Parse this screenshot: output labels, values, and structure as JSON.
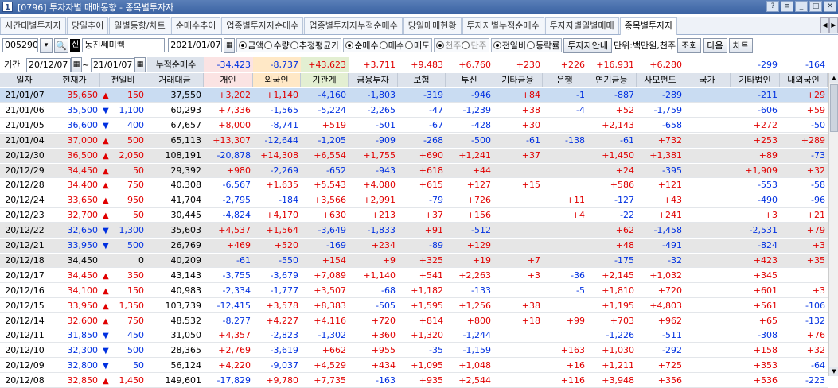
{
  "window": {
    "code": "[0796]",
    "title": "투자자별 매매동향 - 종목별투자자",
    "num": "1"
  },
  "tabs": [
    "시간대별투자자",
    "당일추이",
    "일별동향/차트",
    "순매수추이",
    "업종별투자자순매수",
    "업종별투자자누적순매수",
    "당일매매현황",
    "투자자별누적순매수",
    "투자자별일별매매",
    "종목별투자자"
  ],
  "active_tab": "종목별투자자",
  "stock": {
    "code": "005290",
    "badge": "신",
    "name": "동진쎄미켐",
    "date": "2021/01/07"
  },
  "radios1": [
    {
      "label": "금액",
      "on": true
    },
    {
      "label": "수량",
      "on": false
    },
    {
      "label": "추정평균가",
      "on": false
    }
  ],
  "radios2": [
    {
      "label": "순매수",
      "on": true
    },
    {
      "label": "매수",
      "on": false
    },
    {
      "label": "매도",
      "on": false
    }
  ],
  "radios3": [
    {
      "label": "천주",
      "on": true
    },
    {
      "label": "단주",
      "on": false
    }
  ],
  "radios4": [
    {
      "label": "전일비",
      "on": true
    },
    {
      "label": "등락률",
      "on": false
    }
  ],
  "buttons": {
    "guide": "투자자안내",
    "unit": "단위:백만원,천주",
    "query": "조회",
    "next": "다음",
    "chart": "차트"
  },
  "period": {
    "label": "기간",
    "from": "20/12/07",
    "tilde": "~",
    "to": "21/01/07",
    "cumlabel": "누적순매수"
  },
  "cumulative": [
    "-34,423",
    "-8,737",
    "+43,623",
    "+3,711",
    "+9,483",
    "+6,760",
    "+230",
    "+226",
    "+16,931",
    "+6,280",
    "",
    "-299",
    "-164"
  ],
  "headers": [
    "일자",
    "현재가",
    "전일비",
    "거래대금",
    "개인",
    "외국인",
    "기관계",
    "금융투자",
    "보험",
    "투신",
    "기타금융",
    "은행",
    "연기금등",
    "사모펀드",
    "국가",
    "기타법인",
    "내외국인"
  ],
  "rows": [
    [
      "21/01/07",
      "35,650",
      "up",
      "150",
      "37,550",
      "+3,202",
      "+1,140",
      "-4,160",
      "-1,803",
      "-319",
      "-946",
      "+84",
      "-1",
      "-887",
      "-289",
      "",
      "-211",
      "+29"
    ],
    [
      "21/01/06",
      "35,500",
      "dn",
      "1,100",
      "60,293",
      "+7,336",
      "-1,565",
      "-5,224",
      "-2,265",
      "-47",
      "-1,239",
      "+38",
      "-4",
      "+52",
      "-1,759",
      "",
      "-606",
      "+59"
    ],
    [
      "21/01/05",
      "36,600",
      "dn",
      "400",
      "67,657",
      "+8,000",
      "-8,741",
      "+519",
      "-501",
      "-67",
      "-428",
      "+30",
      "",
      "+2,143",
      "-658",
      "",
      "+272",
      "-50"
    ],
    [
      "21/01/04",
      "37,000",
      "up",
      "500",
      "65,113",
      "+13,307",
      "-12,644",
      "-1,205",
      "-909",
      "-268",
      "-500",
      "-61",
      "-138",
      "-61",
      "+732",
      "",
      "+253",
      "+289"
    ],
    [
      "20/12/30",
      "36,500",
      "up",
      "2,050",
      "108,191",
      "-20,878",
      "+14,308",
      "+6,554",
      "+1,755",
      "+690",
      "+1,241",
      "+37",
      "",
      "+1,450",
      "+1,381",
      "",
      "+89",
      "-73"
    ],
    [
      "20/12/29",
      "34,450",
      "up",
      "50",
      "29,392",
      "+980",
      "-2,269",
      "-652",
      "-943",
      "+618",
      "+44",
      "",
      "",
      "+24",
      "-395",
      "",
      "+1,909",
      "+32"
    ],
    [
      "20/12/28",
      "34,400",
      "up",
      "750",
      "40,308",
      "-6,567",
      "+1,635",
      "+5,543",
      "+4,080",
      "+615",
      "+127",
      "+15",
      "",
      "+586",
      "+121",
      "",
      "-553",
      "-58"
    ],
    [
      "20/12/24",
      "33,650",
      "up",
      "950",
      "41,704",
      "-2,795",
      "-184",
      "+3,566",
      "+2,991",
      "-79",
      "+726",
      "",
      "+11",
      "-127",
      "+43",
      "",
      "-490",
      "-96"
    ],
    [
      "20/12/23",
      "32,700",
      "up",
      "50",
      "30,445",
      "-4,824",
      "+4,170",
      "+630",
      "+213",
      "+37",
      "+156",
      "",
      "+4",
      "-22",
      "+241",
      "",
      "+3",
      "+21"
    ],
    [
      "20/12/22",
      "32,650",
      "dn",
      "1,300",
      "35,603",
      "+4,537",
      "+1,564",
      "-3,649",
      "-1,833",
      "+91",
      "-512",
      "",
      "",
      "+62",
      "-1,458",
      "",
      "-2,531",
      "+79"
    ],
    [
      "20/12/21",
      "33,950",
      "dn",
      "500",
      "26,769",
      "+469",
      "+520",
      "-169",
      "+234",
      "-89",
      "+129",
      "",
      "",
      "+48",
      "-491",
      "",
      "-824",
      "+3"
    ],
    [
      "20/12/18",
      "34,450",
      "",
      "0",
      "40,209",
      "-61",
      "-550",
      "+154",
      "+9",
      "+325",
      "+19",
      "+7",
      "",
      "-175",
      "-32",
      "",
      "+423",
      "+35"
    ],
    [
      "20/12/17",
      "34,450",
      "up",
      "350",
      "43,143",
      "-3,755",
      "-3,679",
      "+7,089",
      "+1,140",
      "+541",
      "+2,263",
      "+3",
      "-36",
      "+2,145",
      "+1,032",
      "",
      "+345",
      ""
    ],
    [
      "20/12/16",
      "34,100",
      "up",
      "150",
      "40,983",
      "-2,334",
      "-1,777",
      "+3,507",
      "-68",
      "+1,182",
      "-133",
      "",
      "-5",
      "+1,810",
      "+720",
      "",
      "+601",
      "+3"
    ],
    [
      "20/12/15",
      "33,950",
      "up",
      "1,350",
      "103,739",
      "-12,415",
      "+3,578",
      "+8,383",
      "-505",
      "+1,595",
      "+1,256",
      "+38",
      "",
      "+1,195",
      "+4,803",
      "",
      "+561",
      "-106"
    ],
    [
      "20/12/14",
      "32,600",
      "up",
      "750",
      "48,532",
      "-8,277",
      "+4,227",
      "+4,116",
      "+720",
      "+814",
      "+800",
      "+18",
      "+99",
      "+703",
      "+962",
      "",
      "+65",
      "-132"
    ],
    [
      "20/12/11",
      "31,850",
      "dn",
      "450",
      "31,050",
      "+4,357",
      "-2,823",
      "-1,302",
      "+360",
      "+1,320",
      "-1,244",
      "",
      "",
      "-1,226",
      "-511",
      "",
      "-308",
      "+76"
    ],
    [
      "20/12/10",
      "32,300",
      "dn",
      "500",
      "28,365",
      "+2,769",
      "-3,619",
      "+662",
      "+955",
      "-35",
      "-1,159",
      "",
      "+163",
      "+1,030",
      "-292",
      "",
      "+158",
      "+32"
    ],
    [
      "20/12/09",
      "32,800",
      "dn",
      "50",
      "56,124",
      "+4,220",
      "-9,037",
      "+4,529",
      "+434",
      "+1,095",
      "+1,048",
      "",
      "+16",
      "+1,211",
      "+725",
      "",
      "+353",
      "-64"
    ],
    [
      "20/12/08",
      "32,850",
      "up",
      "1,450",
      "149,601",
      "-17,829",
      "+9,780",
      "+7,735",
      "-163",
      "+935",
      "+2,544",
      "",
      "+116",
      "+3,948",
      "+356",
      "",
      "+536",
      "-223"
    ]
  ],
  "colors": {
    "highlight_row": "#c9dcf2",
    "gray_row": "#e6e6e6",
    "individual_bg": "#fbe3e3",
    "foreign_bg": "#ffe8c6",
    "inst_bg": "#e3efd2",
    "up": "#e00000",
    "down": "#0030e0"
  }
}
